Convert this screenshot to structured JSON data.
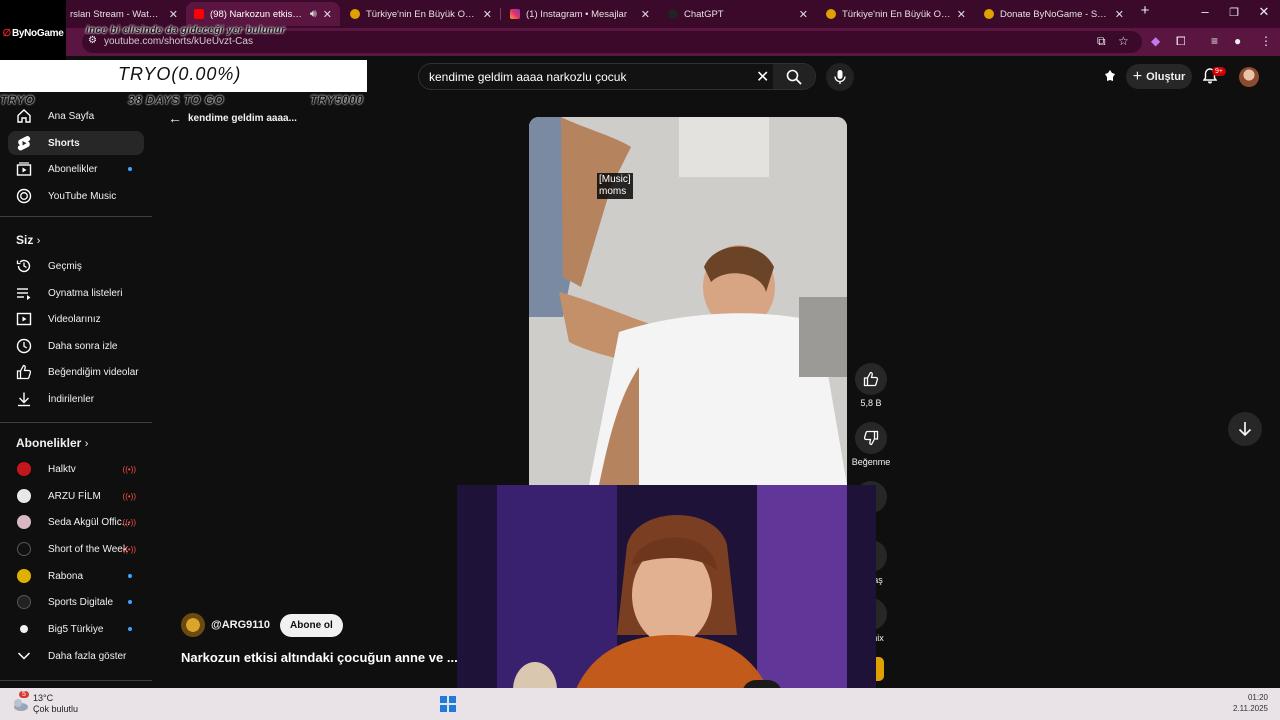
{
  "browser": {
    "tabs": [
      {
        "title": "rslan Stream - Watch Live",
        "active": false
      },
      {
        "title": "(98) Narkozun etkisi altında",
        "active": true
      },
      {
        "title": "Türkiye'nin En Büyük Oyuncu D",
        "active": false
      },
      {
        "title": "(1) Instagram • Mesajlar",
        "active": false
      },
      {
        "title": "ChatGPT",
        "active": false
      },
      {
        "title": "Türkiye'nin En Büyük Oyuncu D",
        "active": false
      },
      {
        "title": "Donate ByNoGame - Streamer",
        "active": false
      }
    ],
    "new_tab": "+",
    "url": "youtube.com/shorts/kUeUvzt-Cas"
  },
  "overlay": {
    "logo_text": "ByNoGame",
    "url_overlay": "ince bi elisinde da gideceği yer bulunur",
    "goal_box": "TRYO(0.00%)",
    "goal_left": "TRYO",
    "goal_mid": "38 DAYS TO GO",
    "goal_right": "TRY5000"
  },
  "search": {
    "query": "kendime geldim aaaa narkozlu çocuk"
  },
  "header": {
    "create_label": "Oluştur",
    "notifications_badge": "9+"
  },
  "sidebar": {
    "main": [
      {
        "label": "Ana Sayfa",
        "icon": "home-icon"
      },
      {
        "label": "Shorts",
        "icon": "shorts-icon",
        "active": true
      },
      {
        "label": "Abonelikler",
        "icon": "subscriptions-icon",
        "dot": true
      },
      {
        "label": "YouTube Music",
        "icon": "music-icon"
      }
    ],
    "you_title": "Siz",
    "you": [
      {
        "label": "Geçmiş",
        "icon": "history-icon"
      },
      {
        "label": "Oynatma listeleri",
        "icon": "playlist-icon"
      },
      {
        "label": "Videolarınız",
        "icon": "your-videos-icon"
      },
      {
        "label": "Daha sonra izle",
        "icon": "watch-later-icon"
      },
      {
        "label": "Beğendiğim videolar",
        "icon": "liked-icon"
      },
      {
        "label": "İndirilenler",
        "icon": "download-icon"
      }
    ],
    "subs_title": "Abonelikler",
    "subs": [
      {
        "label": "Halktv",
        "color": "#c4161c",
        "live": true
      },
      {
        "label": "ARZU FİLM",
        "color": "#e8e8e8",
        "live": true
      },
      {
        "label": "Seda Akgül Offic...",
        "color": "#d9b8c4",
        "live": true
      },
      {
        "label": "Short of the Week",
        "color": "#111111",
        "live": true
      },
      {
        "label": "Rabona",
        "color": "#e0b000",
        "dot": true
      },
      {
        "label": "Sports Digitale",
        "color": "#222222",
        "dot": true
      },
      {
        "label": "Big5 Türkiye",
        "color": "#f1f1f1",
        "dot": true
      }
    ],
    "more_label": "Daha fazla göster"
  },
  "short": {
    "back_title": "kendime geldim aaaa...",
    "captions": [
      "[Music]",
      "moms"
    ],
    "likes": "5,8 B",
    "dislike_label": "Beğenme",
    "partial_labels": [
      "aş",
      "nix"
    ],
    "channel": "@ARG9110",
    "subscribe_label": "Abone ol",
    "title": "Narkozun etkisi altındaki çocuğun anne ve ..."
  },
  "taskbar": {
    "weather_badge": "5",
    "temp": "13°C",
    "condition": "Çok bulutlu",
    "time": "01:20",
    "date": "2.11.2025"
  }
}
